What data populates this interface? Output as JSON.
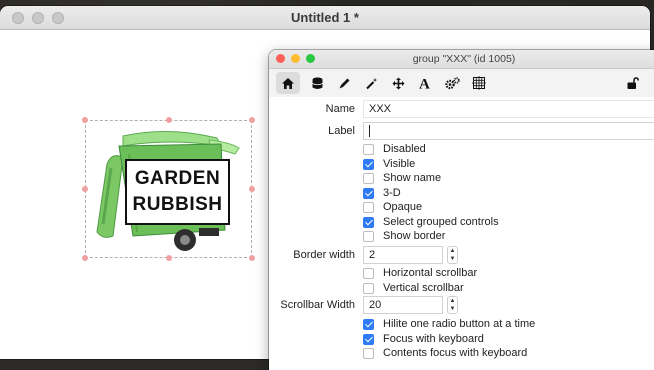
{
  "main_window": {
    "title": "Untitled 1 *"
  },
  "graphic": {
    "label_line1": "GARDEN",
    "label_line2": "RUBBISH",
    "colors": {
      "bin_green": "#6bbf59",
      "bin_dark": "#3e8a3a",
      "lid": "#8fd67a"
    }
  },
  "inspector": {
    "title": "group \"XXX\" (id 1005)",
    "toolbar_icons": [
      "home-icon",
      "database-icon",
      "pencil-icon",
      "wand-icon",
      "move-icon",
      "text-icon",
      "gears-icon",
      "grid-icon",
      "lock-icon"
    ],
    "name_label": "Name",
    "name_value": "XXX",
    "label_label": "Label",
    "label_value": "",
    "border_width_label": "Border width",
    "border_width_value": "2",
    "scrollbar_width_label": "Scrollbar Width",
    "scrollbar_width_value": "20",
    "checkboxes_a": [
      {
        "label": "Disabled",
        "checked": false
      },
      {
        "label": "Visible",
        "checked": true
      },
      {
        "label": "Show name",
        "checked": false
      },
      {
        "label": "3-D",
        "checked": true
      },
      {
        "label": "Opaque",
        "checked": false
      },
      {
        "label": "Select grouped controls",
        "checked": true
      },
      {
        "label": "Show border",
        "checked": false
      }
    ],
    "checkboxes_b": [
      {
        "label": "Horizontal scrollbar",
        "checked": false
      },
      {
        "label": "Vertical scrollbar",
        "checked": false
      }
    ],
    "checkboxes_c": [
      {
        "label": "Hilite one radio button at a time",
        "checked": true
      },
      {
        "label": "Focus with keyboard",
        "checked": true
      },
      {
        "label": "Contents focus with keyboard",
        "checked": false
      }
    ],
    "accent_color": "#2f7bf5"
  }
}
